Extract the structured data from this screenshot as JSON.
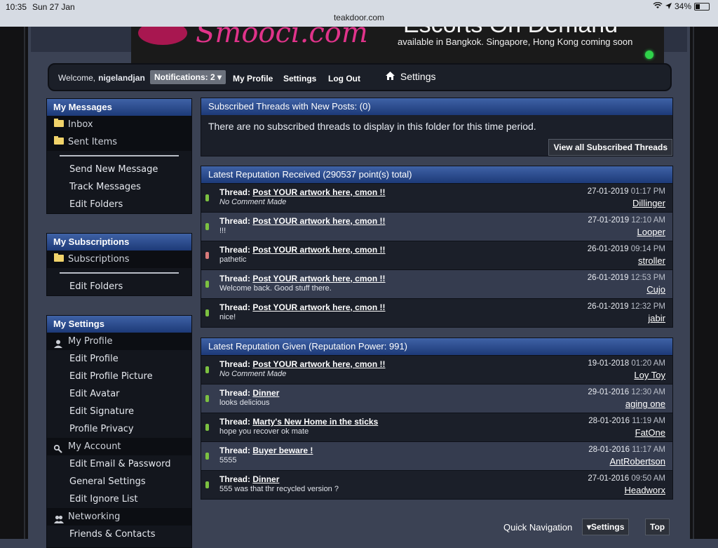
{
  "statusbar": {
    "time": "10:35",
    "date": "Sun 27 Jan",
    "url": "teakdoor.com",
    "battery": "34%"
  },
  "banner": {
    "brand": "Smooci.com",
    "tagline": "Escorts On Demand",
    "subline": "available in Bangkok. Singapore, Hong Kong coming soon"
  },
  "nav": {
    "welcome": "Welcome,",
    "username": "nigelandjan",
    "notifications": "Notifications: 2",
    "my_profile": "My Profile",
    "settings": "Settings",
    "logout": "Log Out",
    "page_title": "Settings"
  },
  "sidebar": {
    "messages": {
      "title": "My Messages",
      "inbox": "Inbox",
      "sent": "Sent Items",
      "send_new": "Send New Message",
      "track": "Track Messages",
      "edit_folders": "Edit Folders"
    },
    "subscriptions": {
      "title": "My Subscriptions",
      "subs": "Subscriptions",
      "edit_folders": "Edit Folders"
    },
    "settings": {
      "title": "My Settings",
      "my_profile": "My Profile",
      "edit_profile": "Edit Profile",
      "edit_picture": "Edit Profile Picture",
      "edit_avatar": "Edit Avatar",
      "edit_signature": "Edit Signature",
      "privacy": "Profile Privacy",
      "my_account": "My Account",
      "edit_email": "Edit Email & Password",
      "general": "General Settings",
      "ignore": "Edit Ignore List",
      "networking": "Networking",
      "friends": "Friends & Contacts"
    }
  },
  "subscribed": {
    "title": "Subscribed Threads with New Posts: (0)",
    "empty": "There are no subscribed threads to display in this folder for this time period.",
    "view_all": "View all Subscribed Threads"
  },
  "received": {
    "title": "Latest Reputation Received (290537 point(s) total)",
    "thread_label": "Thread:",
    "rows": [
      {
        "thread": "Post YOUR artwork here, cmon !!",
        "comment": "No Comment Made",
        "date": "27-01-2019",
        "time": "01:17 PM",
        "user": "Dillinger"
      },
      {
        "thread": "Post YOUR artwork here, cmon !!",
        "comment": "!!!",
        "date": "27-01-2019",
        "time": "12:10 AM",
        "user": "Looper"
      },
      {
        "thread": "Post YOUR artwork here, cmon !!",
        "comment": "pathetic",
        "date": "26-01-2019",
        "time": "09:14 PM",
        "user": "stroller"
      },
      {
        "thread": "Post YOUR artwork here, cmon !!",
        "comment": "Welcome back. Good stuff there.",
        "date": "26-01-2019",
        "time": "12:53 PM",
        "user": "Cujo"
      },
      {
        "thread": "Post YOUR artwork here, cmon !!",
        "comment": "nice!",
        "date": "26-01-2019",
        "time": "12:32 PM",
        "user": "jabir"
      }
    ]
  },
  "given": {
    "title": "Latest Reputation Given (Reputation Power: 991)",
    "thread_label": "Thread:",
    "rows": [
      {
        "thread": "Post YOUR artwork here, cmon !!",
        "comment": "No Comment Made",
        "date": "19-01-2018",
        "time": "01:20 AM",
        "user": "Loy Toy"
      },
      {
        "thread": "Dinner",
        "comment": "looks delicious",
        "date": "29-01-2016",
        "time": "12:30 AM",
        "user": "aging one"
      },
      {
        "thread": "Marty's New Home in the sticks",
        "comment": "hope you recover ok mate",
        "date": "28-01-2016",
        "time": "11:19 AM",
        "user": "FatOne"
      },
      {
        "thread": "Buyer beware !",
        "comment": "5555",
        "date": "28-01-2016",
        "time": "11:17 AM",
        "user": "AntRobertson"
      },
      {
        "thread": "Dinner",
        "comment": "555 was that thr recycled version ?",
        "date": "27-01-2016",
        "time": "09:50 AM",
        "user": "Headworx"
      }
    ]
  },
  "footer": {
    "quick_nav": "Quick Navigation",
    "settings_btn": "Settings",
    "top": "Top"
  }
}
